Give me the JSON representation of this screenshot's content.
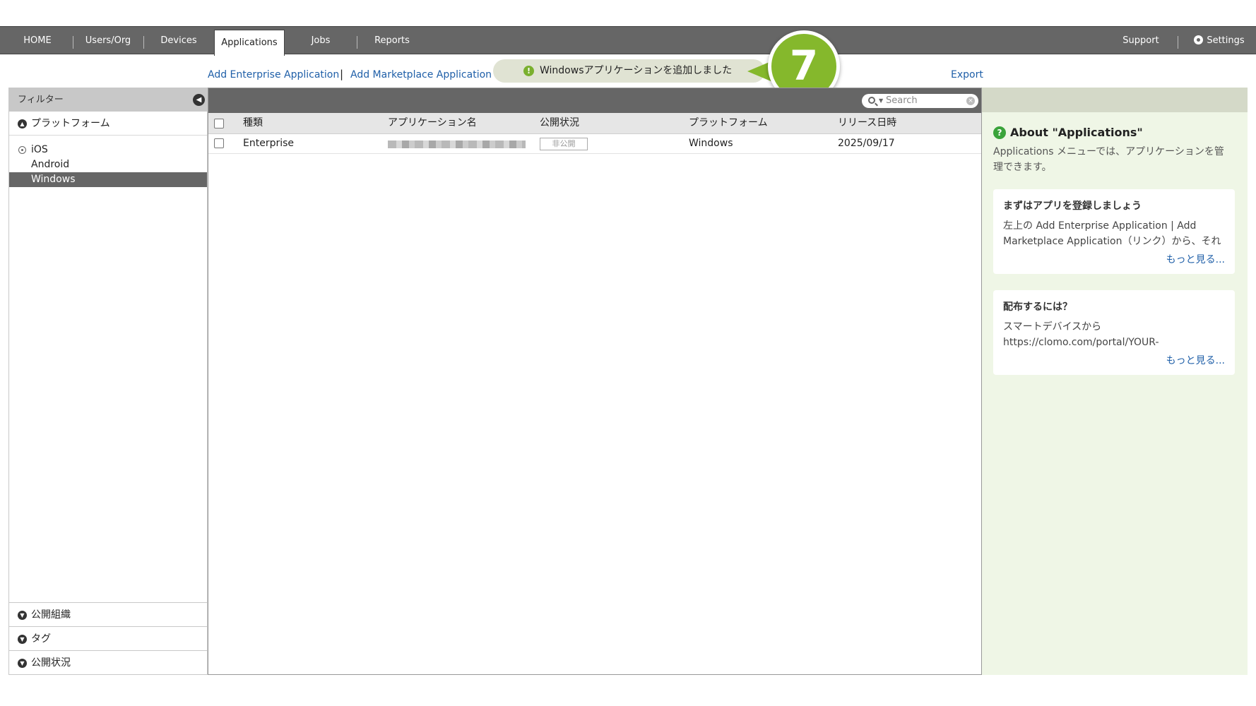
{
  "nav": {
    "items": [
      "HOME",
      "Users/Org",
      "Devices",
      "Applications",
      "Jobs",
      "Reports"
    ],
    "active": "Applications",
    "support": "Support",
    "settings": "Settings"
  },
  "actions": {
    "add_enterprise": "Add Enterprise Application",
    "separator": "|",
    "add_marketplace": "Add Marketplace Application",
    "export": "Export"
  },
  "toast": {
    "icon": "!",
    "message": "Windowsアプリケーションを追加しました"
  },
  "step_badge": "7",
  "filter": {
    "title": "フィルター",
    "platform_section": "プラットフォーム",
    "platforms": [
      "iOS",
      "Android",
      "Windows"
    ],
    "selected_platform": "Windows",
    "sections": [
      "公開組織",
      "タグ",
      "公開状況"
    ]
  },
  "table": {
    "search_placeholder": "Search",
    "columns": [
      "種類",
      "アプリケーション名",
      "公開状況",
      "プラットフォーム",
      "リリース日時"
    ],
    "rows": [
      {
        "type": "Enterprise",
        "name": "",
        "status": "非公開",
        "platform": "Windows",
        "release": "2025/09/17"
      }
    ]
  },
  "help": {
    "title": "About \"Applications\"",
    "description": "Applications メニューでは、アプリケーションを管理できます。",
    "cards": [
      {
        "title": "まずはアプリを登録しましょう",
        "body": "左上の Add Enterprise Application | Add Marketplace Application（リンク）から、それ",
        "more": "もっと見る..."
      },
      {
        "title": "配布するには？",
        "body": "スマートデバイスから https://clomo.com/portal/YOUR-",
        "more": "もっと見る..."
      }
    ]
  },
  "colors": {
    "nav_bg": "#666666",
    "link": "#1f5fa8",
    "accent_green": "#85b82c",
    "help_bg": "#eff6e6"
  }
}
